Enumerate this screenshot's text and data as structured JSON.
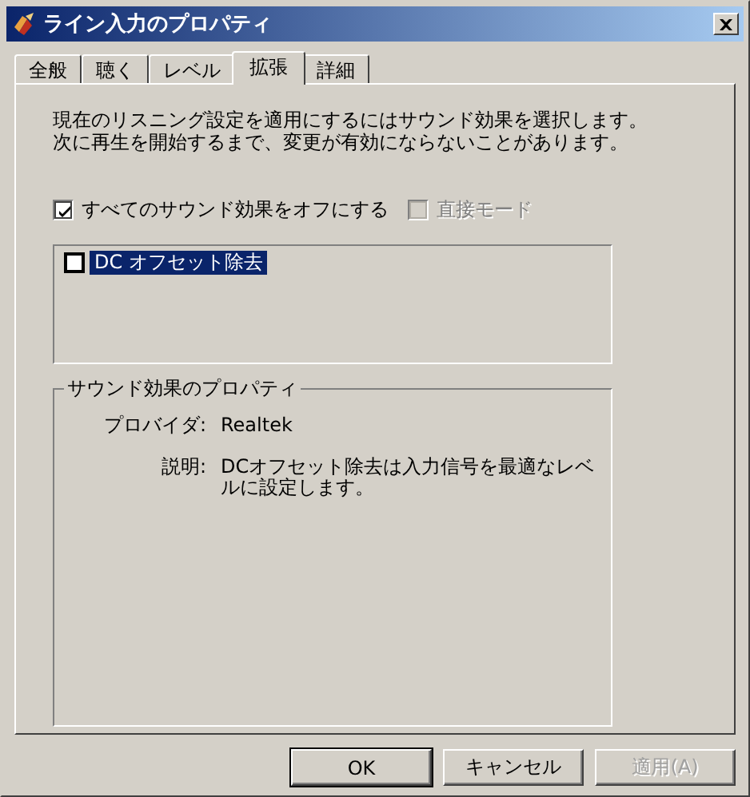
{
  "window": {
    "title": "ライン入力のプロパティ"
  },
  "tabs": [
    {
      "label": "全般",
      "selected": false
    },
    {
      "label": "聴く",
      "selected": false
    },
    {
      "label": "レベル",
      "selected": false
    },
    {
      "label": "拡張",
      "selected": true
    },
    {
      "label": "詳細",
      "selected": false
    }
  ],
  "description": "現在のリスニング設定を適用にするにはサウンド効果を選択します。次に再生を開始するまで、変更が有効にならないことがあります。",
  "options": [
    {
      "label": "すべてのサウンド効果をオフにする",
      "checked": true,
      "disabled": false
    },
    {
      "label": "直接モード",
      "checked": false,
      "disabled": true
    }
  ],
  "effects": [
    {
      "label": "DC オフセット除去",
      "checked": false,
      "selected": true
    }
  ],
  "properties": {
    "title": "サウンド効果のプロパティ",
    "rows": [
      {
        "label": "プロバイダ:",
        "value": "Realtek"
      },
      {
        "label": "説明:",
        "value": "DCオフセット除去は入力信号を最適なレベルに設定します。"
      }
    ]
  },
  "buttons": [
    {
      "label": "OK",
      "default": true,
      "disabled": false
    },
    {
      "label": "キャンセル",
      "default": false,
      "disabled": false
    },
    {
      "label": "適用(A)",
      "default": false,
      "disabled": true
    }
  ]
}
